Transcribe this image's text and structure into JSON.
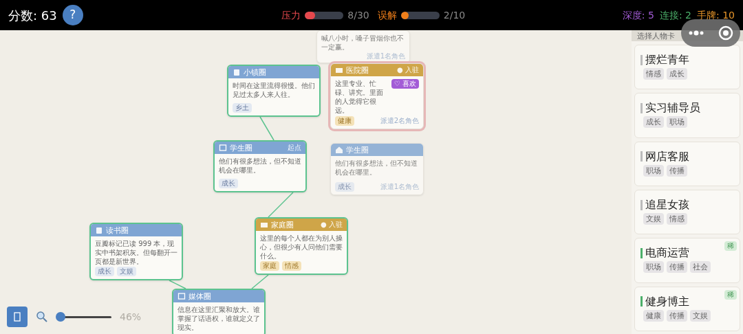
{
  "top_bar": {
    "score": "分数: 63",
    "help": "?",
    "meters": [
      {
        "label": "压力",
        "level": 0.27,
        "reading": "8/30",
        "color": "#e5484d"
      },
      {
        "label": "误解",
        "level": 0.2,
        "reading": "2/10",
        "color": "#f07f1a"
      }
    ],
    "stats": [
      {
        "text": "深度: 5",
        "color": "#a35cd6"
      },
      {
        "text": "连接: 2",
        "color": "#4caf6a"
      },
      {
        "text": "手牌: 10",
        "color": "#e8962a"
      }
    ]
  },
  "nodes": [
    {
      "body": "喊八小时，嗓子冒烟你也不一定赢。",
      "footer": "派遣1名角色",
      "resident": false,
      "connected": false,
      "selected": false,
      "faded": true
    },
    {
      "title": "小镇圈",
      "body": "时间在这里流得很慢。他们见过太多人来人往。",
      "tags": [
        "乡土"
      ],
      "connected": true,
      "resident": false,
      "selected": false,
      "faded": false
    },
    {
      "title": "医院圈",
      "badge": "● 入驻",
      "chip": "♡ 喜欢",
      "body": "这里专业、忙碌、讲究。里面的人觉得它很远。",
      "tags": [
        "健康"
      ],
      "footer": "派遣2名角色",
      "resident": true,
      "connected": false,
      "selected": true,
      "faded": false
    },
    {
      "title": "学生圈",
      "badge": "起点",
      "body": "他们有很多想法，但不知道机会在哪里。",
      "tags": [
        "成长"
      ],
      "resident": false,
      "connected": true,
      "selected": false,
      "faded": false
    },
    {
      "title": "学生圈",
      "body": "他们有很多想法，但不知道机会在哪里。",
      "tags": [
        "成长"
      ],
      "footer": "派遣1名角色",
      "resident": false,
      "connected": false,
      "selected": false,
      "faded": true
    },
    {
      "title": "读书圈",
      "body": "豆瓣标记已读 999 本，现实中书架积灰。但每翻开一页都是新世界。",
      "tags": [
        "成长",
        "文娱"
      ],
      "resident": false,
      "connected": true,
      "selected": false,
      "faded": false
    },
    {
      "title": "家庭圈",
      "badge": "● 入驻",
      "body": "这里的每个人都在为别人操心，但很少有人问他们需要什么。",
      "tags": [
        "家庭",
        "情感"
      ],
      "resident": true,
      "connected": true,
      "selected": false,
      "faded": false
    },
    {
      "title": "媒体圈",
      "body": "信息在这里汇聚和放大。谁掌握了话语权，谁就定义了现实。",
      "resident": false,
      "connected": true,
      "selected": false,
      "faded": false
    }
  ],
  "zoom": {
    "level": 0.08,
    "reading": "46%"
  },
  "panel": {
    "title": "选择人物卡",
    "cards": [
      {
        "name": "摆烂青年",
        "tags": [
          "情感",
          "成长"
        ],
        "rare": false
      },
      {
        "name": "实习辅导员",
        "tags": [
          "成长",
          "职场"
        ],
        "rare": false
      },
      {
        "name": "网店客服",
        "tags": [
          "职场",
          "传播"
        ],
        "rare": false
      },
      {
        "name": "追星女孩",
        "tags": [
          "文娱",
          "情感"
        ],
        "rare": false
      },
      {
        "name": "电商运营",
        "tags": [
          "职场",
          "传播",
          "社会"
        ],
        "rare": true,
        "rare_label": "稀"
      },
      {
        "name": "健身博主",
        "tags": [
          "健康",
          "传播",
          "文娱"
        ],
        "rare": true,
        "rare_label": "稀"
      }
    ]
  }
}
